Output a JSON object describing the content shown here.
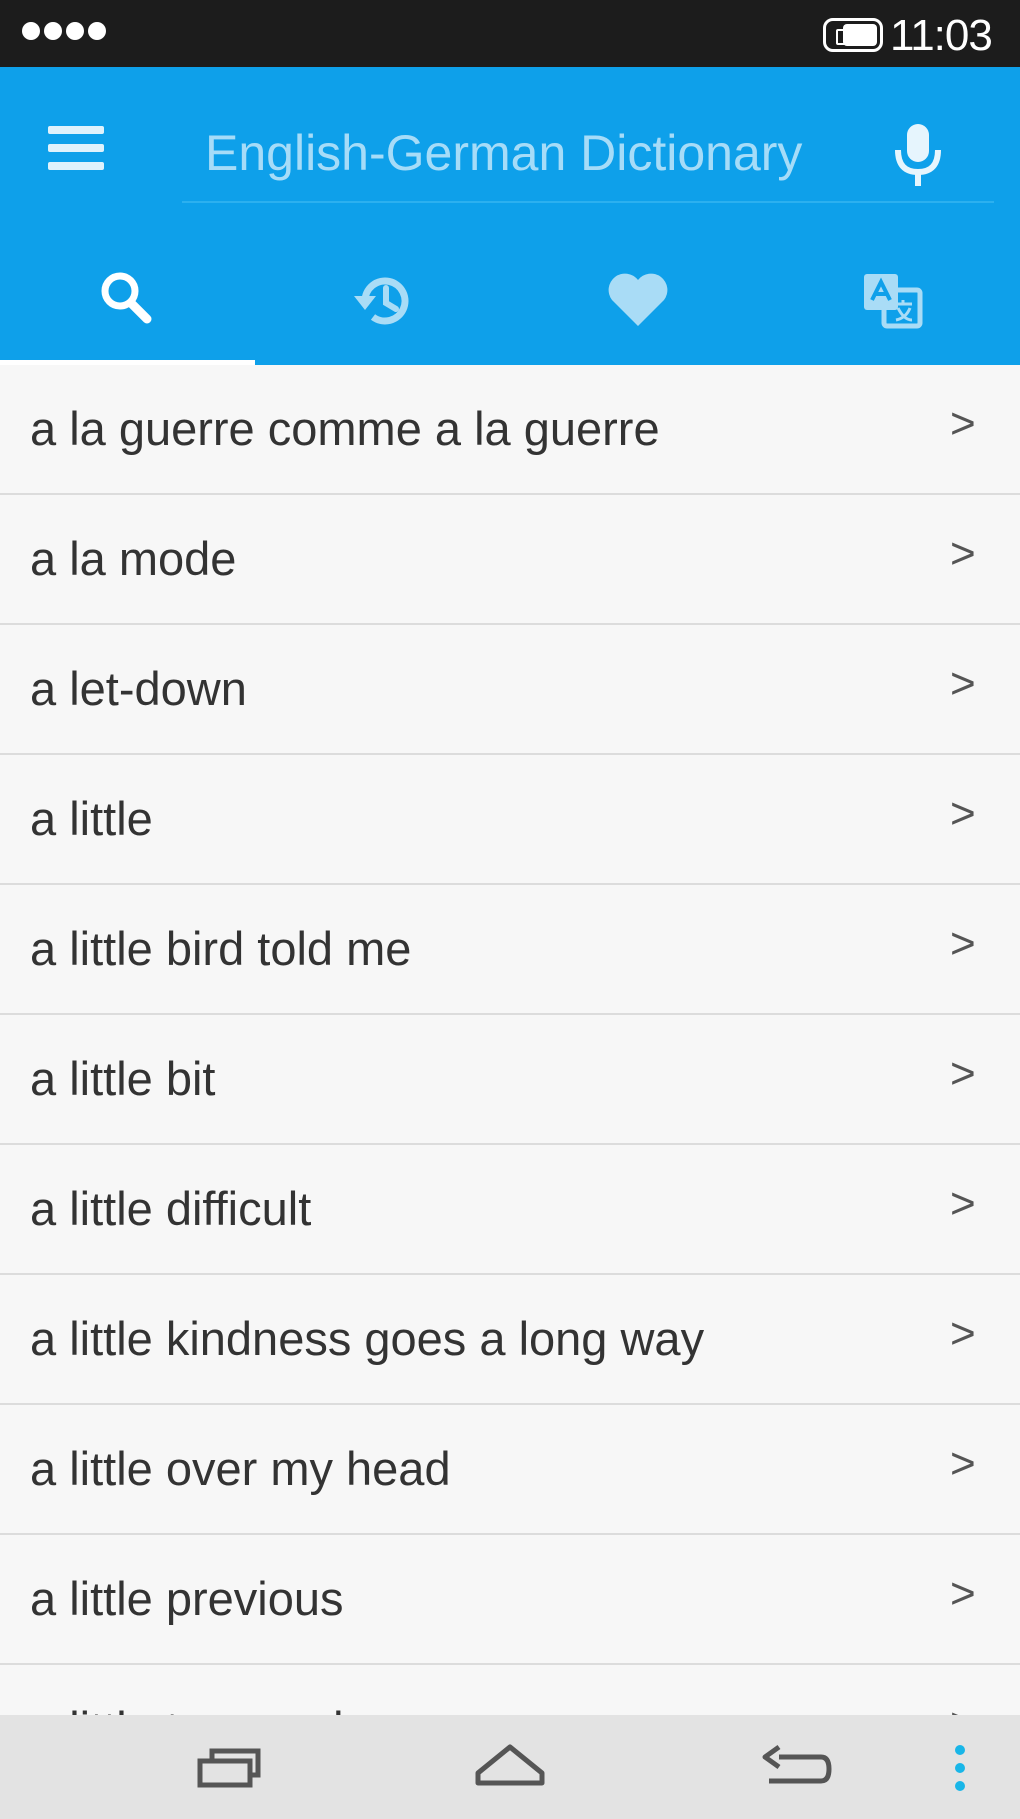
{
  "status_bar": {
    "time": "11:03",
    "signal_icon": "signal-dots-icon",
    "battery_icon": "battery-icon"
  },
  "app_bar": {
    "search_title": "English-German Dictionary",
    "menu_icon": "hamburger-menu-icon",
    "mic_icon": "microphone-icon"
  },
  "tabs": [
    {
      "icon": "search-icon",
      "selected": true
    },
    {
      "icon": "history-icon",
      "selected": false
    },
    {
      "icon": "heart-icon",
      "selected": false
    },
    {
      "icon": "translate-icon",
      "selected": false
    }
  ],
  "list": {
    "items": [
      "a la guerre comme a la guerre",
      "a la mode",
      "a let-down",
      "a little",
      "a little bird told me",
      "a little bit",
      "a little difficult",
      "a little kindness goes a long way",
      "a little over my head",
      "a little previous",
      "a little too much"
    ],
    "chevron": ">"
  },
  "nav_bar": {
    "recent_icon": "recent-apps-icon",
    "home_icon": "home-icon",
    "back_icon": "back-icon",
    "overflow_icon": "overflow-menu-icon"
  },
  "colors": {
    "app_bar": "#0ea0ea",
    "status_bar": "#1c1c1c",
    "list_background": "#f7f7f7",
    "nav_bar": "#e3e3e3",
    "overflow_dots": "#19b6e8"
  }
}
